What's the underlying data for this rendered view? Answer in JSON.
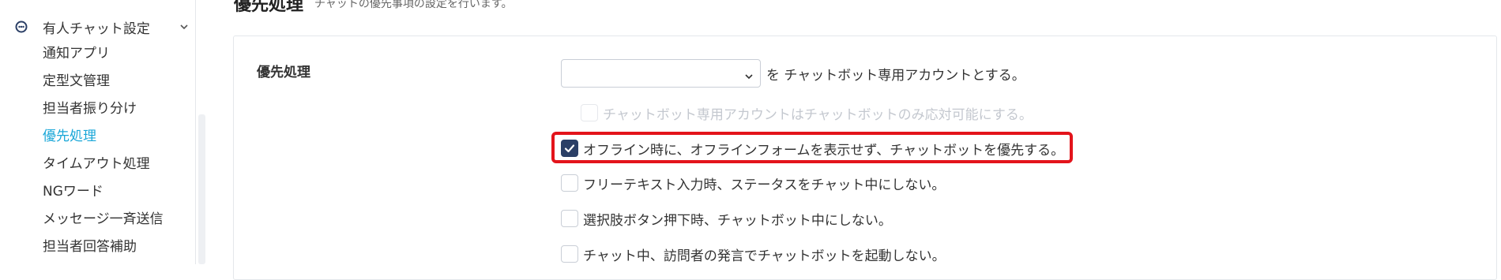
{
  "sidebar": {
    "group": {
      "label": "有人チャット設定"
    },
    "items": [
      {
        "label": "通知アプリ",
        "active": false
      },
      {
        "label": "定型文管理",
        "active": false
      },
      {
        "label": "担当者振り分け",
        "active": false
      },
      {
        "label": "優先処理",
        "active": true
      },
      {
        "label": "タイムアウト処理",
        "active": false
      },
      {
        "label": "NGワード",
        "active": false
      },
      {
        "label": "メッセージ一斉送信",
        "active": false
      },
      {
        "label": "担当者回答補助",
        "active": false
      }
    ]
  },
  "header": {
    "title": "優先処理",
    "subtitle": "チャットの優先事項の設定を行います。"
  },
  "section": {
    "label": "優先処理",
    "select": {
      "value": "",
      "suffix": "を チャットボット専用アカウントとする。"
    },
    "options": [
      {
        "label": "チャットボット専用アカウントはチャットボットのみ応対可能にする。",
        "checked": false,
        "disabled": true
      },
      {
        "label": "オフライン時に、オフラインフォームを表示せず、チャットボットを優先する。",
        "checked": true,
        "disabled": false
      },
      {
        "label": "フリーテキスト入力時、ステータスをチャット中にしない。",
        "checked": false,
        "disabled": false
      },
      {
        "label": "選択肢ボタン押下時、チャットボット中にしない。",
        "checked": false,
        "disabled": false
      },
      {
        "label": "チャット中、訪問者の発言でチャットボットを起動しない。",
        "checked": false,
        "disabled": false
      }
    ]
  },
  "colors": {
    "accent": "#1aa7d8",
    "checkbox_checked": "#2b3f66",
    "highlight": "#e3141b"
  }
}
